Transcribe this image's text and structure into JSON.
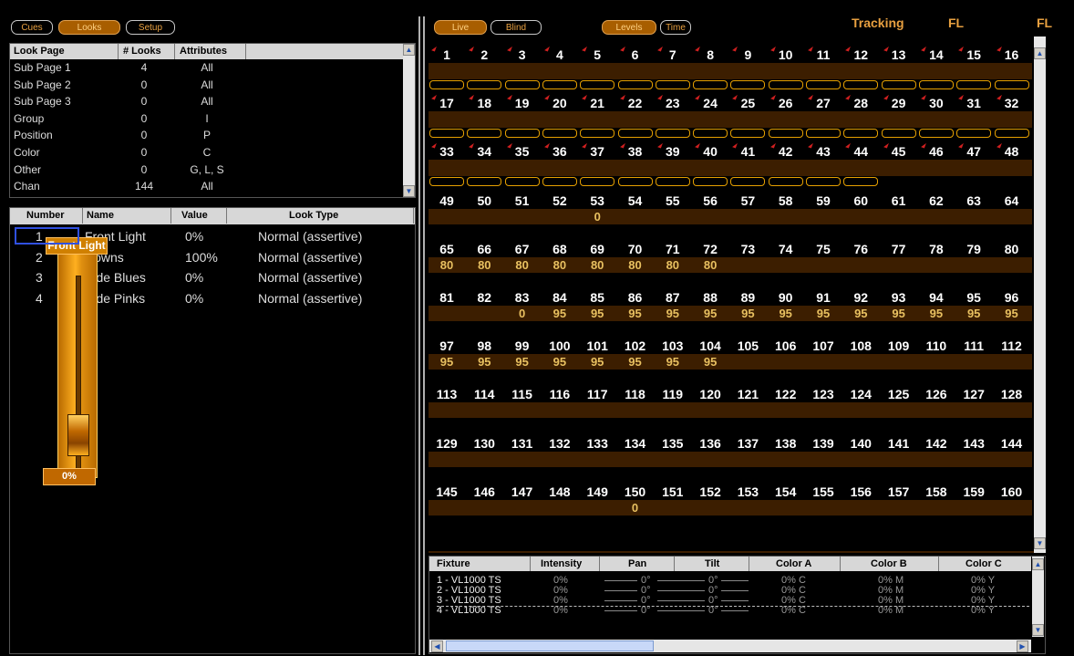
{
  "left_tabs": [
    {
      "label": "Cues",
      "active": false
    },
    {
      "label": "Looks",
      "active": true
    },
    {
      "label": "Setup",
      "active": false
    }
  ],
  "right_tabs": [
    {
      "label": "Live",
      "active": true
    },
    {
      "label": "Blind",
      "active": false
    },
    {
      "label": "Levels",
      "active": true
    },
    {
      "label": "Time",
      "active": false
    }
  ],
  "status": {
    "tracking": "Tracking",
    "fl1": "FL",
    "fl2": "FL"
  },
  "look_pages": {
    "headers": [
      "Look Page",
      "# Looks",
      "Attributes"
    ],
    "rows": [
      [
        "Sub Page 1",
        "4",
        "All"
      ],
      [
        "Sub Page 2",
        "0",
        "All"
      ],
      [
        "Sub Page 3",
        "0",
        "All"
      ],
      [
        "Group",
        "0",
        "I"
      ],
      [
        "Position",
        "0",
        "P"
      ],
      [
        "Color",
        "0",
        "C"
      ],
      [
        "Other",
        "0",
        "G, L, S"
      ],
      [
        "Chan",
        "144",
        "All"
      ]
    ]
  },
  "looks_table": {
    "headers": [
      "Number",
      "Name",
      "Value",
      "Look Type"
    ],
    "rows": [
      [
        "1",
        "Front Light",
        "0%",
        "Normal (assertive)"
      ],
      [
        "2",
        "Downs",
        "100%",
        "Normal (assertive)"
      ],
      [
        "3",
        "Side Blues",
        "0%",
        "Normal (assertive)"
      ],
      [
        "4",
        "Side Pinks",
        "0%",
        "Normal (assertive)"
      ]
    ]
  },
  "fader": {
    "label": "Front Light",
    "value": "0%"
  },
  "channel_grid": {
    "rows": [
      {
        "channels": [
          "1",
          "2",
          "3",
          "4",
          "5",
          "6",
          "7",
          "8",
          "9",
          "10",
          "11",
          "12",
          "13",
          "14",
          "15",
          "16"
        ],
        "values": [
          "",
          "",
          "",
          "",
          "",
          "",
          "",
          "",
          "",
          "",
          "",
          "",
          "",
          "",
          "",
          ""
        ]
      },
      {
        "channels": [
          "17",
          "18",
          "19",
          "20",
          "21",
          "22",
          "23",
          "24",
          "25",
          "26",
          "27",
          "28",
          "29",
          "30",
          "31",
          "32"
        ],
        "values": [
          "",
          "",
          "",
          "",
          "",
          "",
          "",
          "",
          "",
          "",
          "",
          "",
          "",
          "",
          "",
          ""
        ]
      },
      {
        "channels": [
          "33",
          "34",
          "35",
          "36",
          "37",
          "38",
          "39",
          "40",
          "41",
          "42",
          "43",
          "44",
          "45",
          "46",
          "47",
          "48"
        ],
        "values": [
          "",
          "",
          "",
          "",
          "",
          "",
          "",
          "",
          "",
          "",
          "",
          "",
          "",
          "",
          "",
          ""
        ]
      },
      {
        "channels": [
          "49",
          "50",
          "51",
          "52",
          "53",
          "54",
          "55",
          "56",
          "57",
          "58",
          "59",
          "60",
          "61",
          "62",
          "63",
          "64"
        ],
        "values": [
          "",
          "",
          "",
          "",
          "0",
          "",
          "",
          "",
          "",
          "",
          "",
          "",
          "",
          "",
          "",
          ""
        ]
      },
      {
        "channels": [
          "65",
          "66",
          "67",
          "68",
          "69",
          "70",
          "71",
          "72",
          "73",
          "74",
          "75",
          "76",
          "77",
          "78",
          "79",
          "80"
        ],
        "values": [
          "80",
          "80",
          "80",
          "80",
          "80",
          "80",
          "80",
          "80",
          "",
          "",
          "",
          "",
          "",
          "",
          "",
          ""
        ]
      },
      {
        "channels": [
          "81",
          "82",
          "83",
          "84",
          "85",
          "86",
          "87",
          "88",
          "89",
          "90",
          "91",
          "92",
          "93",
          "94",
          "95",
          "96"
        ],
        "values": [
          "",
          "",
          "0",
          "95",
          "95",
          "95",
          "95",
          "95",
          "95",
          "95",
          "95",
          "95",
          "95",
          "95",
          "95",
          "95"
        ]
      },
      {
        "channels": [
          "97",
          "98",
          "99",
          "100",
          "101",
          "102",
          "103",
          "104",
          "105",
          "106",
          "107",
          "108",
          "109",
          "110",
          "111",
          "112"
        ],
        "values": [
          "95",
          "95",
          "95",
          "95",
          "95",
          "95",
          "95",
          "95",
          "",
          "",
          "",
          "",
          "",
          "",
          "",
          ""
        ]
      },
      {
        "channels": [
          "113",
          "114",
          "115",
          "116",
          "117",
          "118",
          "119",
          "120",
          "121",
          "122",
          "123",
          "124",
          "125",
          "126",
          "127",
          "128"
        ],
        "values": [
          "",
          "",
          "",
          "",
          "",
          "",
          "",
          "",
          "",
          "",
          "",
          "",
          "",
          "",
          "",
          ""
        ]
      },
      {
        "channels": [
          "129",
          "130",
          "131",
          "132",
          "133",
          "134",
          "135",
          "136",
          "137",
          "138",
          "139",
          "140",
          "141",
          "142",
          "143",
          "144"
        ],
        "values": [
          "",
          "",
          "",
          "",
          "",
          "",
          "",
          "",
          "",
          "",
          "",
          "",
          "",
          "",
          "",
          ""
        ]
      },
      {
        "channels": [
          "145",
          "146",
          "147",
          "148",
          "149",
          "150",
          "151",
          "152",
          "153",
          "154",
          "155",
          "156",
          "157",
          "158",
          "159",
          "160"
        ],
        "values": [
          "",
          "",
          "",
          "",
          "",
          "0",
          "",
          "",
          "",
          "",
          "",
          "",
          "",
          "",
          "",
          ""
        ]
      }
    ]
  },
  "fixture_table": {
    "headers": [
      "Fixture",
      "Intensity",
      "Pan",
      "Tilt",
      "Color A",
      "Color B",
      "Color C"
    ],
    "rows": [
      [
        "1 - VL1000 TS",
        "0%",
        "0°",
        "0°",
        "0% C",
        "0% M",
        "0% Y"
      ],
      [
        "2 - VL1000 TS",
        "0%",
        "0°",
        "0°",
        "0% C",
        "0% M",
        "0% Y"
      ],
      [
        "3 - VL1000 TS",
        "0%",
        "0°",
        "0°",
        "0% C",
        "0% M",
        "0% Y"
      ],
      [
        "4 - VL1000 TS",
        "0%",
        "0°",
        "0°",
        "0% C",
        "0% M",
        "0% Y"
      ]
    ]
  },
  "colors": {
    "accent": "#e6a000",
    "band": "#3c1e00",
    "value_text": "#e8c060"
  }
}
